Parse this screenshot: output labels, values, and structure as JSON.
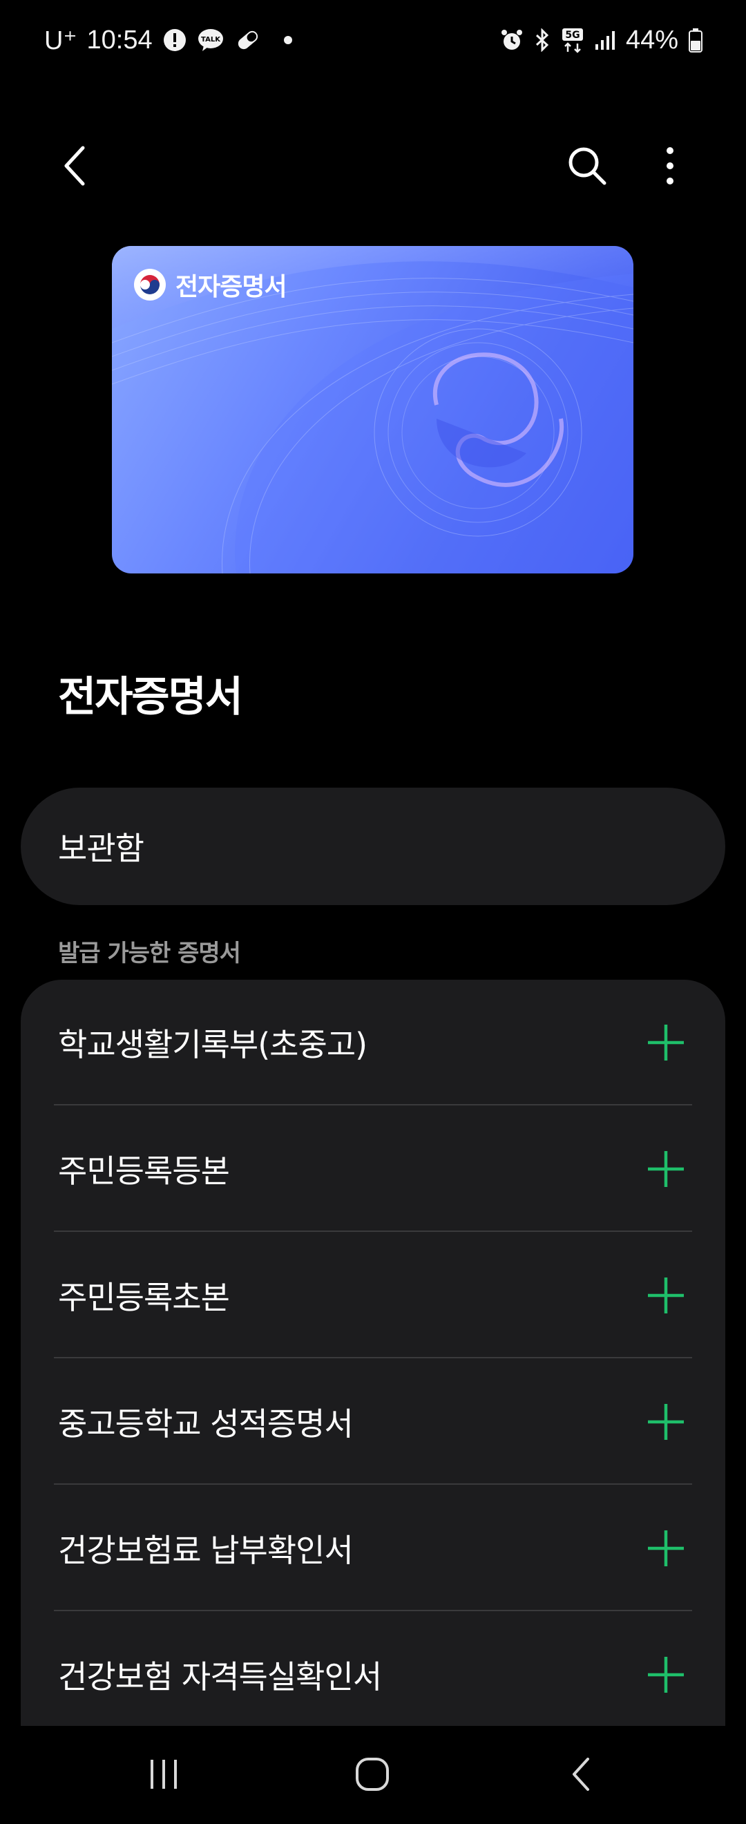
{
  "status_bar": {
    "carrier": "U⁺",
    "time": "10:54",
    "battery": "44%",
    "icons": [
      "alert-icon",
      "kakaotalk-icon",
      "pill-icon",
      "alarm-icon",
      "bluetooth-icon",
      "5g-icon",
      "signal-icon",
      "battery-icon"
    ]
  },
  "app_bar": {
    "icons": [
      "back-icon",
      "search-icon",
      "more-icon"
    ]
  },
  "card": {
    "title": "전자증명서",
    "colors": {
      "start": "#8aa8ff",
      "end": "#3f58f0"
    }
  },
  "page": {
    "title": "전자증명서"
  },
  "storage": {
    "label": "보관함"
  },
  "section": {
    "header": "발급 가능한 증명서"
  },
  "certificates": [
    {
      "label": "학교생활기록부(초중고)"
    },
    {
      "label": "주민등록등본"
    },
    {
      "label": "주민등록초본"
    },
    {
      "label": "중고등학교 성적증명서"
    },
    {
      "label": "건강보험료 납부확인서"
    },
    {
      "label": "건강보험 자격득실확인서"
    }
  ],
  "accent_color": "#1fbf6a",
  "nav": {
    "icons": [
      "recent-apps-icon",
      "home-icon",
      "back-icon"
    ]
  }
}
